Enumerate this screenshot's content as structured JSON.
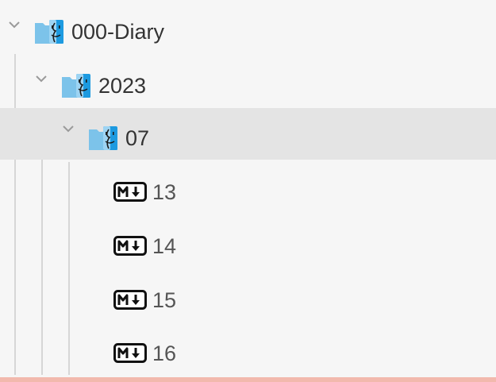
{
  "tree": {
    "folders": [
      {
        "label": "000-Diary",
        "expanded": true
      },
      {
        "label": "2023",
        "expanded": true
      },
      {
        "label": "07",
        "expanded": true,
        "selected": true
      }
    ],
    "files": [
      {
        "label": "13",
        "icon": "markdown-icon"
      },
      {
        "label": "14",
        "icon": "markdown-icon"
      },
      {
        "label": "15",
        "icon": "markdown-icon"
      },
      {
        "label": "16",
        "icon": "markdown-icon"
      }
    ]
  },
  "colors": {
    "background": "#f6f6f6",
    "selected_row": "#e4e4e4",
    "guide_line": "#d6d6d6",
    "folder_light": "#7cc3ea",
    "folder_dark": "#1d9ae0",
    "bottom_bar": "#f2b9ad"
  }
}
